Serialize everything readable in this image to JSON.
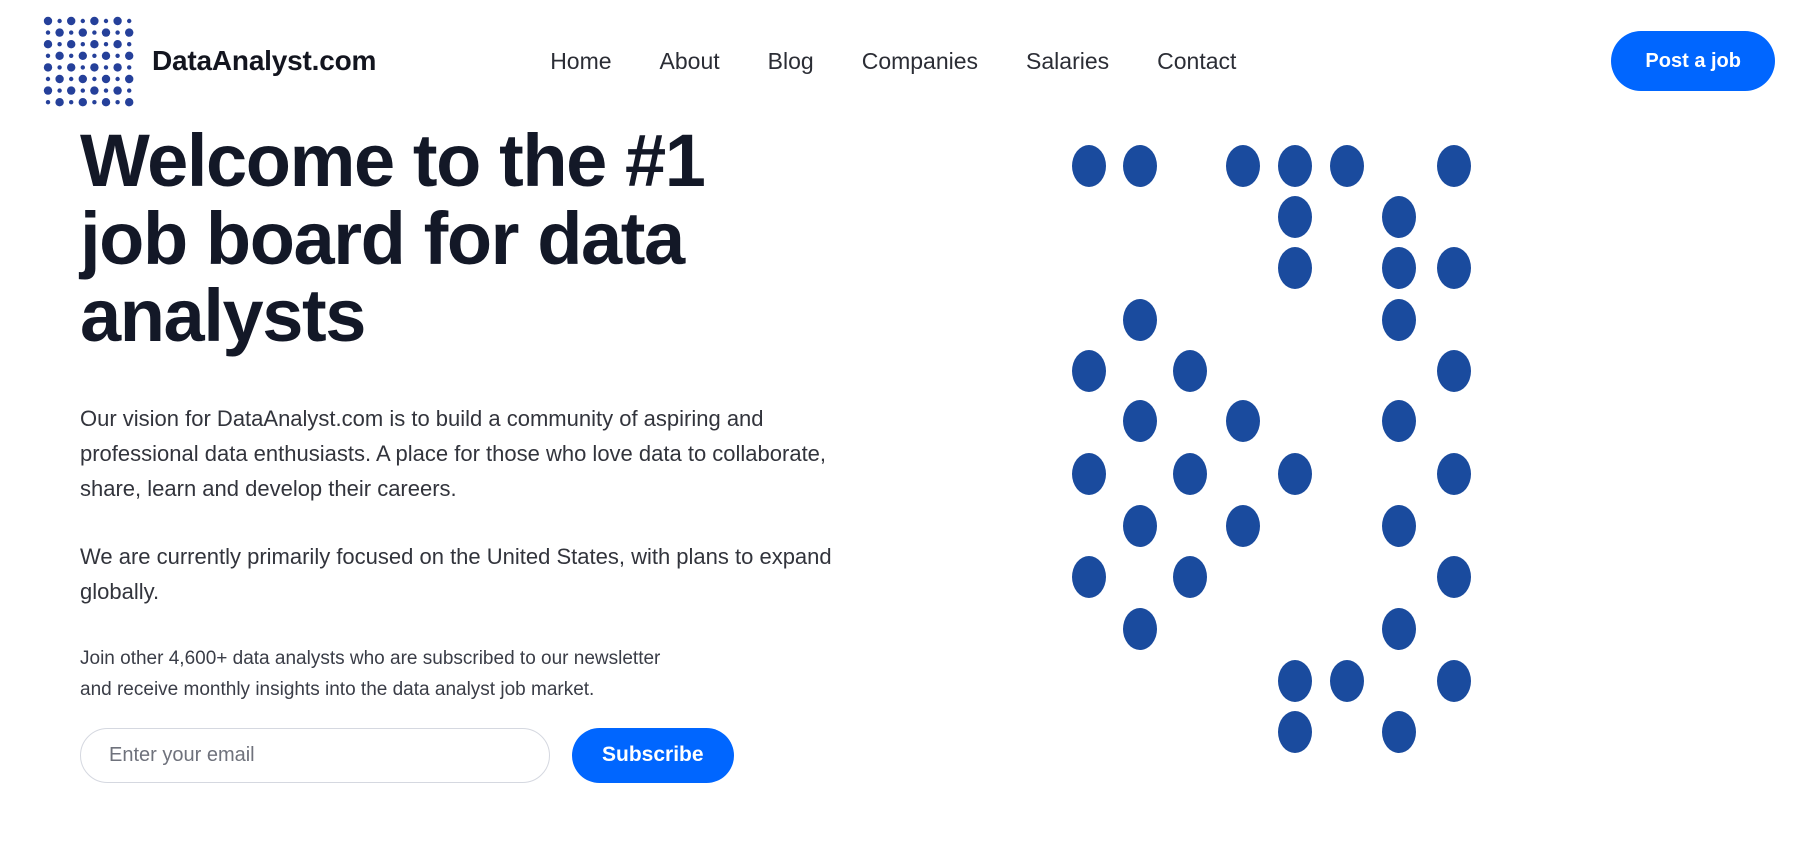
{
  "header": {
    "brand_name": "DataAnalyst.com",
    "logo_icon": "dot-grid-logo-icon",
    "nav": [
      {
        "label": "Home",
        "name": "nav-link-home"
      },
      {
        "label": "About",
        "name": "nav-link-about"
      },
      {
        "label": "Blog",
        "name": "nav-link-blog"
      },
      {
        "label": "Companies",
        "name": "nav-link-companies"
      },
      {
        "label": "Salaries",
        "name": "nav-link-salaries"
      },
      {
        "label": "Contact",
        "name": "nav-link-contact"
      }
    ],
    "post_job_label": "Post a job"
  },
  "hero": {
    "title": "Welcome to the #1 job board for data analysts",
    "paragraph_1": "Our vision for DataAnalyst.com is to build a community of aspiring and professional data enthusiasts. A place for those who love data to collaborate, share, learn and develop their careers.",
    "paragraph_2": "We are currently primarily focused on the United States, with plans to expand globally.",
    "newsletter_note": "Join other 4,600+ data analysts who are subscribed to our newsletter and receive monthly insights into the data analyst job market.",
    "email_placeholder": "Enter your email",
    "email_value": "",
    "subscribe_label": "Subscribe"
  },
  "decoration": {
    "dot_art_name": "dot-pattern-graphic",
    "dot_columns": [
      825,
      877,
      1036,
      1089,
      1140,
      1190,
      1243,
      1295,
      1347,
      1399,
      1454
    ],
    "dot_rows": [
      166,
      217,
      268,
      320,
      371,
      421,
      474,
      526,
      577,
      629,
      681,
      732
    ],
    "dot_cells": [
      [
        0,
        1,
        3,
        4,
        6,
        7,
        8,
        10
      ],
      [
        1,
        7,
        9
      ],
      [
        0,
        7,
        9,
        10
      ],
      [
        1,
        4,
        9
      ],
      [
        0,
        3,
        5,
        10
      ],
      [
        1,
        4,
        6,
        9
      ],
      [
        0,
        3,
        5,
        7,
        10
      ],
      [
        1,
        4,
        6,
        9
      ],
      [
        0,
        3,
        5,
        10
      ],
      [
        1,
        4,
        9
      ],
      [
        0,
        7,
        8,
        10
      ],
      [
        1,
        7,
        9
      ]
    ]
  },
  "colors": {
    "accent_blue": "#0066ff",
    "dot_blue": "#1a4b9e",
    "logo_blue": "#25409a",
    "heading_navy": "#131827",
    "body_text": "#32343c",
    "background": "#ffffff",
    "input_border": "#d5d8e0"
  }
}
